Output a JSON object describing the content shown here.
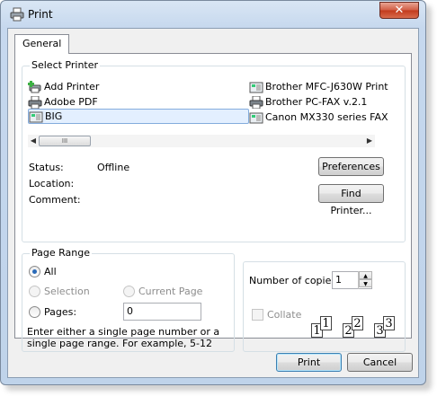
{
  "window": {
    "title": "Print",
    "close_glyph": "✕"
  },
  "tabs": [
    {
      "label": "General"
    }
  ],
  "select_printer": {
    "title": "Select Printer",
    "printers": [
      {
        "name": "Add Printer",
        "icon": "add-printer-icon"
      },
      {
        "name": "Adobe PDF",
        "icon": "printer-icon"
      },
      {
        "name": "BIG",
        "icon": "fax-icon",
        "selected": true
      },
      {
        "name": "Brother MFC-J630W Print",
        "icon": "fax-icon"
      },
      {
        "name": "Brother PC-FAX v.2.1",
        "icon": "printer-icon"
      },
      {
        "name": "Canon MX330 series FAX",
        "icon": "fax-icon"
      }
    ],
    "scroll_thumb_glyph": "III",
    "status_label": "Status:",
    "status_value": "Offline",
    "location_label": "Location:",
    "location_value": "",
    "comment_label": "Comment:",
    "comment_value": "",
    "preferences_button": "Preferences",
    "find_printer_button": "Find Printer..."
  },
  "page_range": {
    "title": "Page Range",
    "all_label": "All",
    "selection_label": "Selection",
    "current_page_label": "Current Page",
    "pages_label": "Pages:",
    "pages_value": "0",
    "hint": "Enter either a single page number or a single page range.  For example, 5-12"
  },
  "copies": {
    "number_label": "Number of copies:",
    "number_value": "1",
    "collate_label": "Collate",
    "collate_pages": [
      "1",
      "1",
      "2",
      "2",
      "3",
      "3"
    ]
  },
  "buttons": {
    "print": "Print",
    "cancel": "Cancel"
  }
}
